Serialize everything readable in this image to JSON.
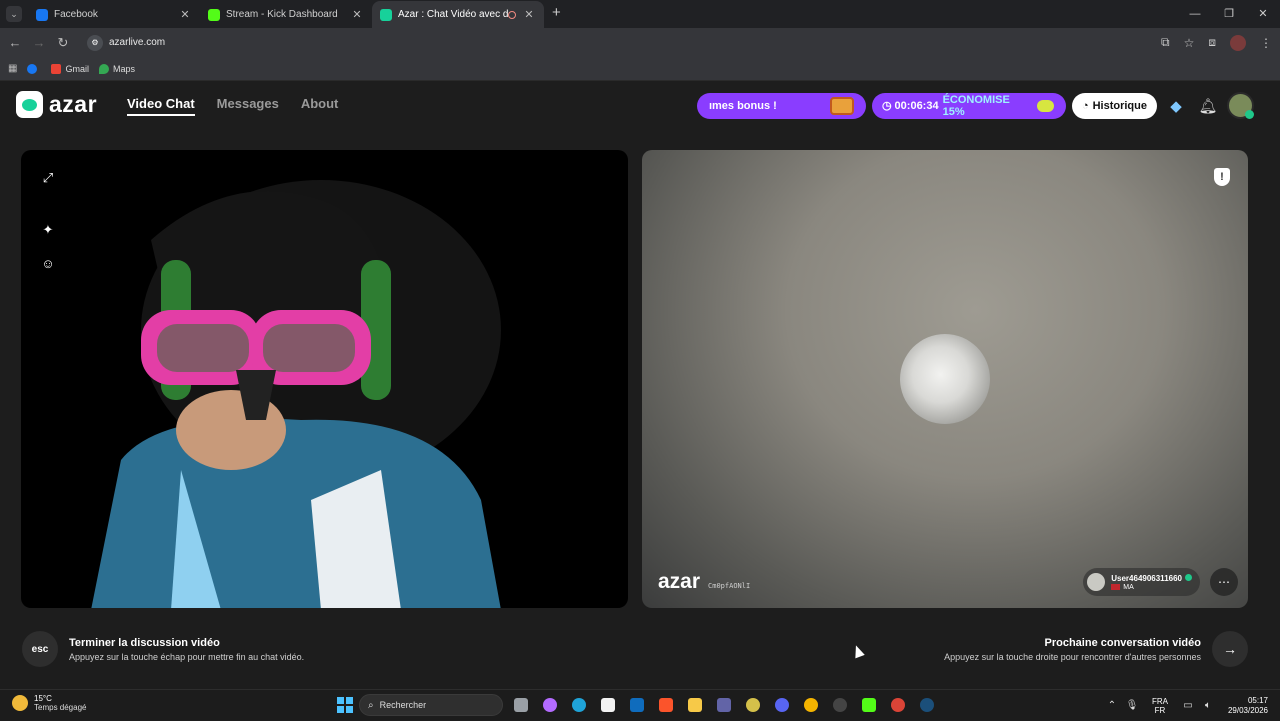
{
  "browser": {
    "tabs": [
      {
        "title": "Facebook",
        "favicon_color": "#1877f2"
      },
      {
        "title": "Stream - Kick Dashboard",
        "favicon_color": "#53fc18"
      },
      {
        "title": "Azar : Chat Vidéo avec de n",
        "favicon_color": "#17d19a",
        "recording": true
      }
    ],
    "new_tab": "+",
    "url": "azarlive.com",
    "bookmarks": [
      {
        "label": "Gmail",
        "color": "#ea4335"
      },
      {
        "label": "Maps",
        "color": "#34a853"
      }
    ]
  },
  "header": {
    "logo_text": "azar",
    "nav": [
      {
        "label": "Video Chat",
        "active": true
      },
      {
        "label": "Messages",
        "active": false
      },
      {
        "label": "About",
        "active": false
      }
    ],
    "bonus_label": "ımes bonus !",
    "timer": "00:06:34",
    "savings": "ÉCONOMISE 15%",
    "history_label": "Historique"
  },
  "local_video": {
    "tools": [
      "expand-icon",
      "magic-wand-icon",
      "sticker-icon"
    ]
  },
  "remote_video": {
    "watermark": "azar",
    "watermark_code": "Cm0pfAONlI",
    "username": "User464906311660",
    "country": "MA"
  },
  "footer": {
    "esc_key": "esc",
    "end_title": "Terminer la discussion vidéo",
    "end_sub": "Appuyez sur la touche échap pour mettre fin au chat vidéo.",
    "next_title": "Prochaine conversation vidéo",
    "next_sub": "Appuyez sur la touche droite pour rencontrer d'autres personnes"
  },
  "taskbar": {
    "temp": "15°C",
    "weather": "Temps dégagé",
    "search_placeholder": "Rechercher",
    "lang_top": "FRA",
    "lang_bottom": "FR",
    "time": "05:17",
    "date": "29/03/2026"
  },
  "colors": {
    "accent": "#8a3dff",
    "brand": "#17d19a"
  }
}
